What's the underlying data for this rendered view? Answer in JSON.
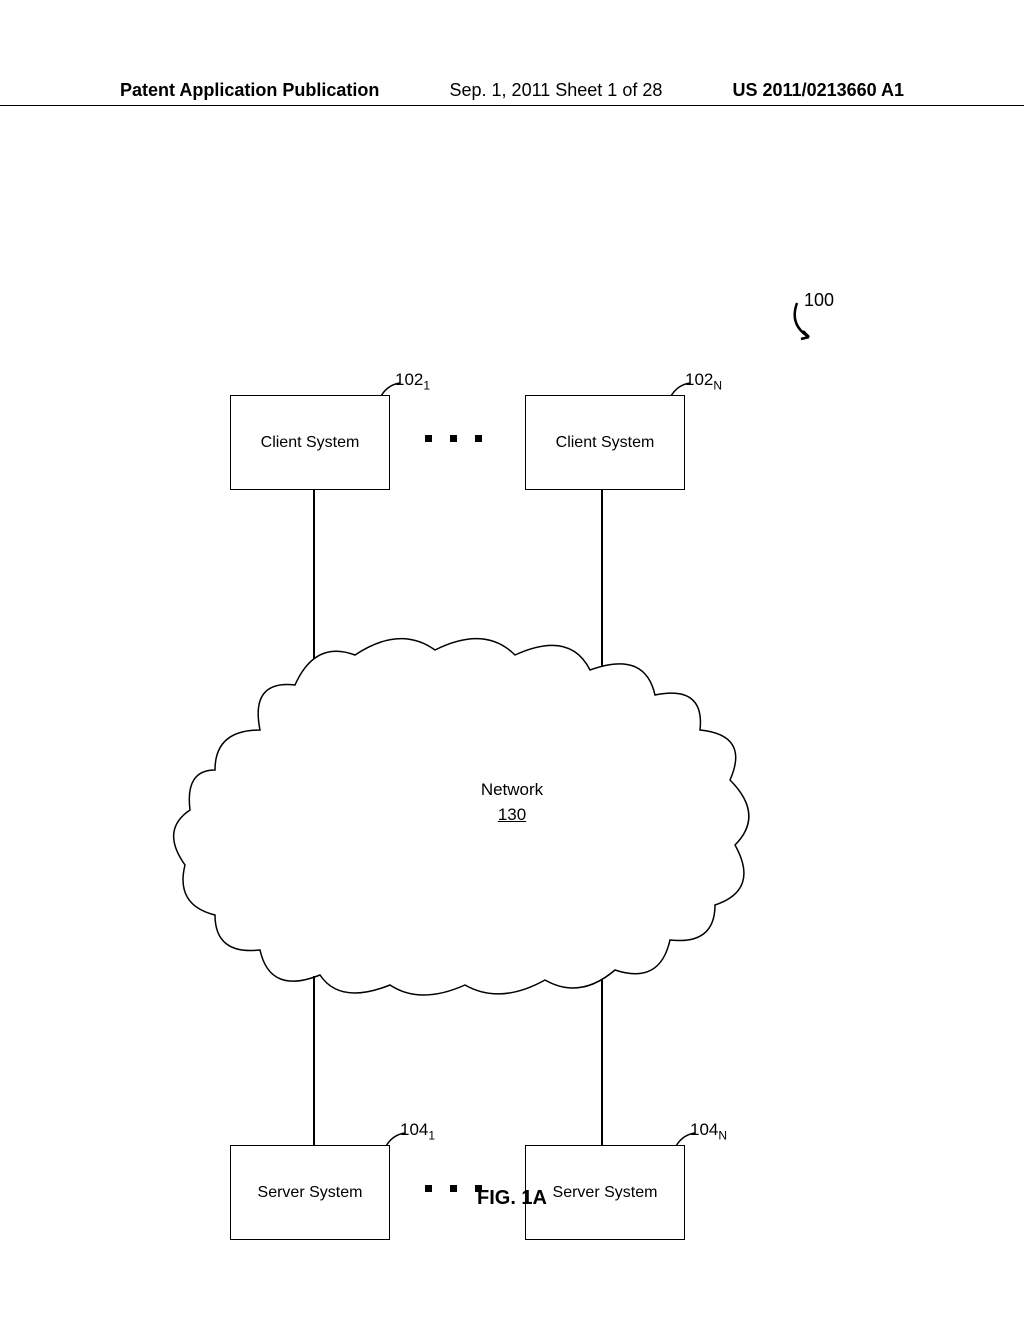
{
  "header": {
    "left": "Patent Application Publication",
    "center": "Sep. 1, 2011   Sheet 1 of 28",
    "right": "US 2011/0213660 A1"
  },
  "figure": {
    "ref": "100",
    "caption": "FIG. 1A",
    "client_label": "Client System",
    "server_label": "Server System",
    "network_label": "Network",
    "network_num": "130",
    "c1_base": "102",
    "c1_sub": "1",
    "c2_base": "102",
    "c2_sub": "N",
    "s1_base": "104",
    "s1_sub": "1",
    "s2_base": "104",
    "s2_sub": "N"
  }
}
